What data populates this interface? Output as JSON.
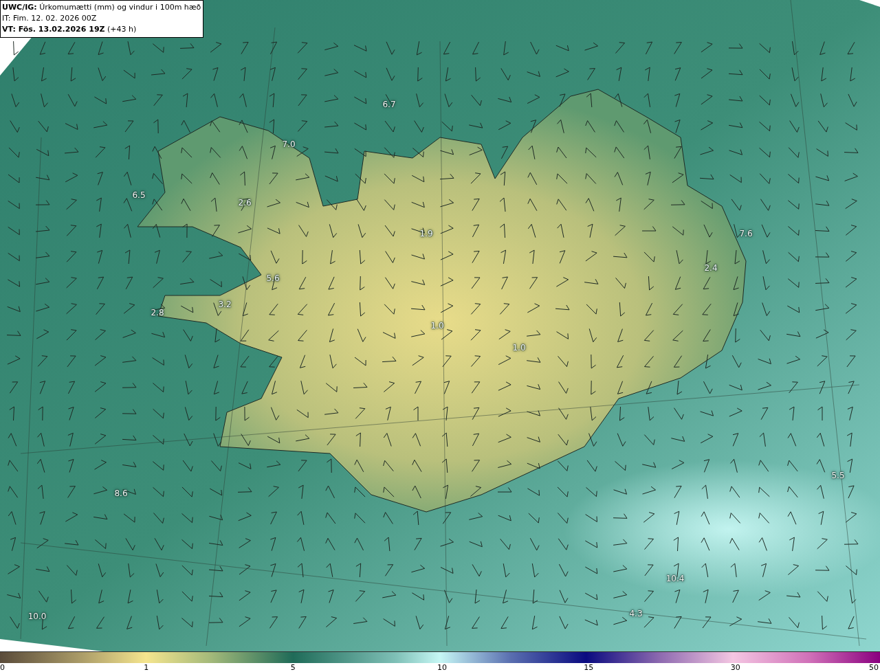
{
  "title_box": {
    "lines": [
      "**UWC/IG:** Úrkomumætti (mm) og vindur i 100m hæð",
      "IT: Fim. 12. 02. 2026 00Z",
      "**VT: Fös. 13.02.2026 19Z** (+43 h)"
    ]
  },
  "map_labels": [
    "6.7",
    "7.0",
    "6.5",
    "2.6",
    "1.9",
    "7.6",
    "5.6",
    "2.4",
    "2.8",
    "3.2",
    "1.0",
    "1.0",
    "8.6",
    "5.5",
    "10.4",
    "4.3",
    "10.0"
  ],
  "color_scale": {
    "ticks": [
      "0",
      "1",
      "5",
      "10",
      "15",
      "30",
      "50"
    ]
  }
}
